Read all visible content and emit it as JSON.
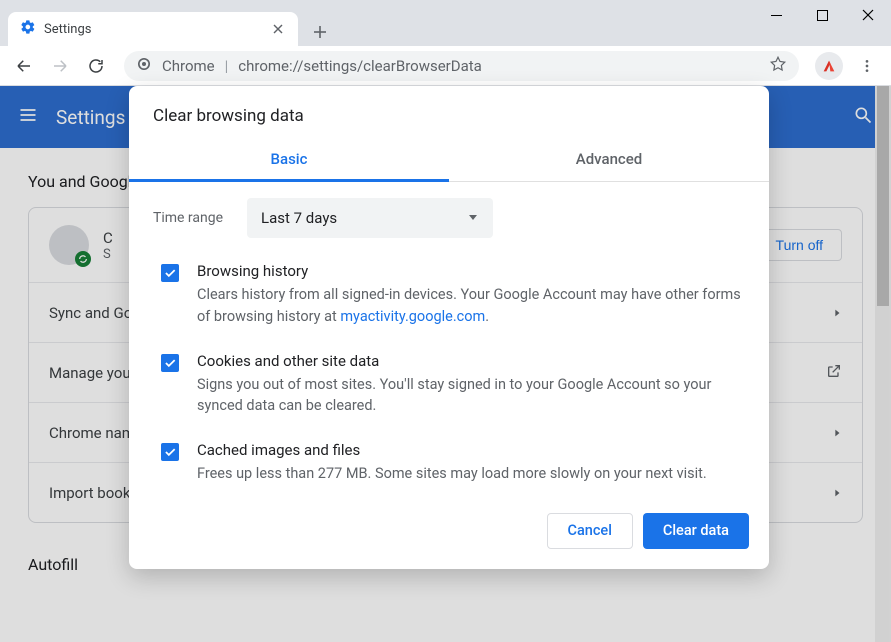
{
  "window": {
    "tab_title": "Settings"
  },
  "toolbar": {
    "url_product": "Chrome",
    "url_path": "chrome://settings/clearBrowserData"
  },
  "settings_page": {
    "header_title": "Settings",
    "section_you": "You and Google",
    "profile_initial": "C",
    "profile_sub": "S",
    "turn_off": "Turn off",
    "rows": {
      "sync": "Sync and Google services",
      "manage": "Manage your Google Account",
      "chrome_name": "Chrome name and picture",
      "import": "Import bookmarks and settings"
    },
    "autofill": "Autofill"
  },
  "dialog": {
    "title": "Clear browsing data",
    "tab_basic": "Basic",
    "tab_advanced": "Advanced",
    "time_range_label": "Time range",
    "time_range_value": "Last 7 days",
    "options": {
      "history": {
        "title": "Browsing history",
        "desc_pre": "Clears history from all signed-in devices. Your Google Account may have other forms of browsing history at ",
        "desc_link": "myactivity.google.com",
        "desc_post": "."
      },
      "cookies": {
        "title": "Cookies and other site data",
        "desc": "Signs you out of most sites. You'll stay signed in to your Google Account so your synced data can be cleared."
      },
      "cache": {
        "title": "Cached images and files",
        "desc": "Frees up less than 277 MB. Some sites may load more slowly on your next visit."
      }
    },
    "cancel": "Cancel",
    "clear": "Clear data"
  }
}
